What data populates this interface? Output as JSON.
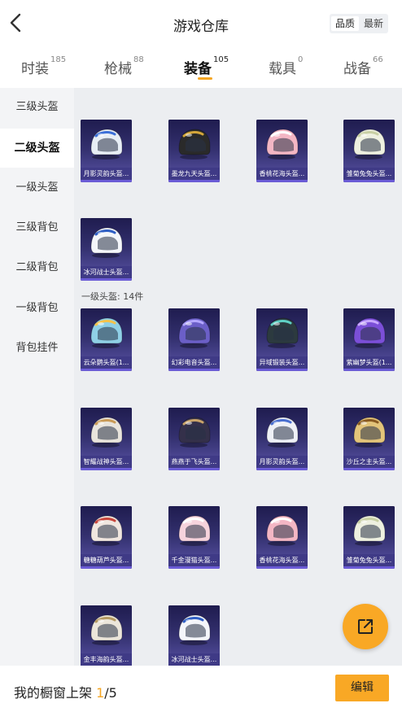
{
  "header": {
    "title": "游戏仓库",
    "sort_quality": "品质",
    "sort_newest": "最新"
  },
  "tabs": [
    {
      "label": "时装",
      "count": "185"
    },
    {
      "label": "枪械",
      "count": "88"
    },
    {
      "label": "装备",
      "count": "105"
    },
    {
      "label": "载具",
      "count": "0"
    },
    {
      "label": "战备",
      "count": "66"
    }
  ],
  "sidebar": [
    {
      "label": "三级头盔"
    },
    {
      "label": "二级头盔"
    },
    {
      "label": "一级头盔"
    },
    {
      "label": "三级背包"
    },
    {
      "label": "二级背包"
    },
    {
      "label": "一级背包"
    },
    {
      "label": "背包挂件"
    }
  ],
  "sections": {
    "level1_title": "一级头盔: 14件"
  },
  "items_level2": [
    {
      "name": "月影灵韵头盔...",
      "color": "#e8eef5",
      "accent": "#3b6fd8"
    },
    {
      "name": "墨龙九天头盔...",
      "color": "#2a2a2a",
      "accent": "#d4a63a"
    },
    {
      "name": "香桃花海头盔...",
      "color": "#f3b6c4",
      "accent": "#ffffff"
    },
    {
      "name": "雏菊兔兔头盔...",
      "color": "#eef0e0",
      "accent": "#c8cfa3"
    },
    {
      "name": "冰河战士头盔...",
      "color": "#f4f6fa",
      "accent": "#2f5fc4"
    }
  ],
  "items_level1": [
    {
      "name": "云朵鹦头盔(1...",
      "color": "#8fd0e6",
      "accent": "#f5c34a"
    },
    {
      "name": "幻彩电音头盔...",
      "color": "#6b5fc7",
      "accent": "#b3a7ff"
    },
    {
      "name": "异域锻装头盔...",
      "color": "#2c3a3f",
      "accent": "#5fd0c4"
    },
    {
      "name": "紫幽梦头盔(1...",
      "color": "#7b4fd8",
      "accent": "#c8a8ff"
    },
    {
      "name": "智耀战神头盔...",
      "color": "#e9e4dc",
      "accent": "#c99a56"
    },
    {
      "name": "燕燕于飞头盔...",
      "color": "#34304a",
      "accent": "#c9a36a"
    },
    {
      "name": "月影灵韵头盔...",
      "color": "#eef0f6",
      "accent": "#4a6fd0"
    },
    {
      "name": "沙丘之主头盔...",
      "color": "#e3c47a",
      "accent": "#8a5b22"
    },
    {
      "name": "糖糖葫芦头盔...",
      "color": "#f0e6df",
      "accent": "#c8463c"
    },
    {
      "name": "千金漫猫头盔...",
      "color": "#f6d3dc",
      "accent": "#ffffff"
    },
    {
      "name": "香桃花海头盔...",
      "color": "#f3b6c4",
      "accent": "#ffffff"
    },
    {
      "name": "雏菊兔兔头盔...",
      "color": "#eef0e0",
      "accent": "#c8cfa3"
    },
    {
      "name": "金丰海韵头盔...",
      "color": "#ece6da",
      "accent": "#b59a62"
    },
    {
      "name": "冰河战士头盔...",
      "color": "#f4f6fa",
      "accent": "#2f5fc4"
    }
  ],
  "footer": {
    "prefix": "我的橱窗上架 ",
    "current": "1",
    "total": "/5",
    "edit_label": "编辑"
  },
  "colors": {
    "accent": "#f9a825",
    "card_bg": "#2a2660"
  },
  "icons": {
    "back": "chevron-left-icon",
    "share": "external-link-icon"
  }
}
